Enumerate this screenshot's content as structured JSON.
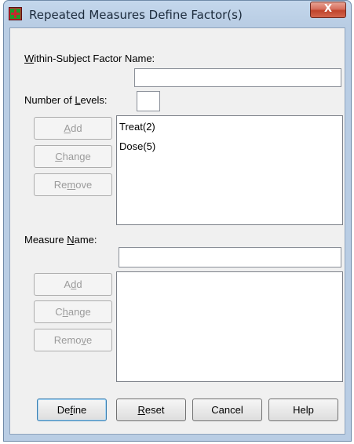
{
  "window": {
    "title": "Repeated Measures Define Factor(s)",
    "close_glyph": "X"
  },
  "factor": {
    "name_label": "Within-Subject Factor Name:",
    "name_value": "",
    "levels_label": "Number of Levels:",
    "levels_value": ""
  },
  "factor_buttons": {
    "add": "Add",
    "change": "Change",
    "remove": "Remove"
  },
  "factor_list": [
    "Treat(2)",
    "Dose(5)"
  ],
  "measure": {
    "name_label": "Measure Name:",
    "name_value": ""
  },
  "measure_buttons": {
    "add": "Add",
    "change": "Change",
    "remove": "Remove"
  },
  "footer": {
    "define": "Define",
    "reset": "Reset",
    "cancel": "Cancel",
    "help": "Help"
  },
  "colors": {
    "client_bg": "#f0f0f0",
    "title_bg": "#b9cde4",
    "close_red": "#c0442c",
    "icon_green": "#1e9b2b",
    "icon_red": "#c8282d"
  }
}
